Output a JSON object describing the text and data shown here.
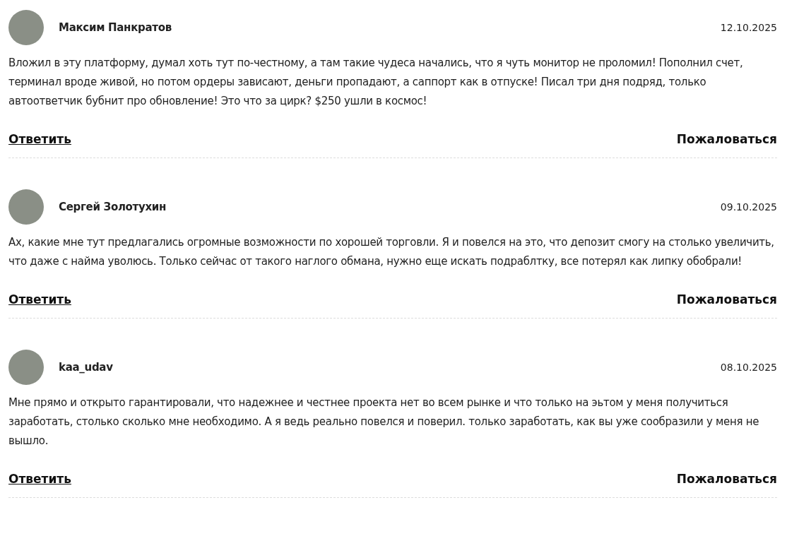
{
  "comments": [
    {
      "author": "Максим Панкратов",
      "date": "12.10.2025",
      "text": "Вложил в эту платформу, думал хоть тут по-честному, а там такие чудеса начались, что я чуть монитор не проломил! Пополнил счет, терминал вроде живой, но потом ордеры зависают, деньги пропадают, а саппорт как в отпуске! Писал три дня подряд, только автоответчик бубнит про обновление! Это что за цирк? $250 ушли в космос!",
      "reply": "Ответить",
      "report": "Пожаловаться"
    },
    {
      "author": "Сергей Золотухин",
      "date": "09.10.2025",
      "text": "Ах, какие мне тут предлагались огромные возможности по хорошей торговли. Я и повелся на это, что депозит смогу на столько увеличить, что даже с найма уволюсь. Только сейчас от такого наглого обмана, нужно еще искать подраблтку, все потерял как липку обобрали!",
      "reply": "Ответить",
      "report": "Пожаловаться"
    },
    {
      "author": "kaa_udav",
      "date": "08.10.2025",
      "text": "Мне прямо и открыто гарантировали, что надежнее и честнее проекта нет во всем рынке и что только на эьтом у меня получиться заработать, столько сколько мне необходимо. А я ведь реально повелся и поверил. только заработать, как вы уже сообразили у меня не вышло.",
      "reply": "Ответить",
      "report": "Пожаловаться"
    }
  ]
}
